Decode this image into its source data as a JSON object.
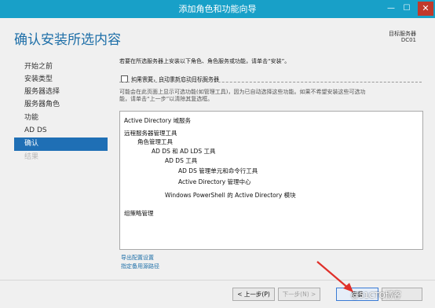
{
  "window": {
    "title": "添加角色和功能向导",
    "minimize_glyph": "—",
    "maximize_glyph": "☐",
    "close_glyph": "✕"
  },
  "header": {
    "page_title": "确认安装所选内容",
    "destination_label": "目标服务器",
    "destination_value": "DC01"
  },
  "nav": {
    "items": [
      {
        "label": "开始之前",
        "state": "normal"
      },
      {
        "label": "安装类型",
        "state": "normal"
      },
      {
        "label": "服务器选择",
        "state": "normal"
      },
      {
        "label": "服务器角色",
        "state": "normal"
      },
      {
        "label": "功能",
        "state": "normal"
      },
      {
        "label": "AD DS",
        "state": "normal"
      },
      {
        "label": "确认",
        "state": "active"
      },
      {
        "label": "结果",
        "state": "disabled"
      }
    ]
  },
  "content": {
    "intro": "若要在所选服务器上安装以下角色、角色服务或功能，请单击“安装”。",
    "restart_checkbox": {
      "label": "如果需要，自动重新启动目标服务器",
      "checked": false
    },
    "note_line1": "可能会在此页面上显示可选功能(如管理工具)，因为已自动选择这些功能。如果不希望安装这些可选功",
    "note_line2": "能，请单击“上一步”以清除其复选框。",
    "features": [
      "Active Directory 域服务",
      "远程服务器管理工具",
      "角色管理工具",
      "AD DS 和 AD LDS 工具",
      "AD DS 工具",
      "AD DS 管理单元和命令行工具",
      "Active Directory 管理中心",
      "Windows PowerShell 的 Active Directory 模块",
      "组策略管理"
    ],
    "export_link": "导出配置设置",
    "alt_source_link": "指定备用源路径"
  },
  "footer": {
    "prev": "< 上一步(P)",
    "next": "下一步(N) >",
    "install": "安装",
    "watermark": "@51CTO博客"
  },
  "colors": {
    "titlebar": "#18a0c8",
    "accent": "#1f6fb5",
    "title_blue": "#1e6fa8",
    "arrow": "#e0302a"
  }
}
